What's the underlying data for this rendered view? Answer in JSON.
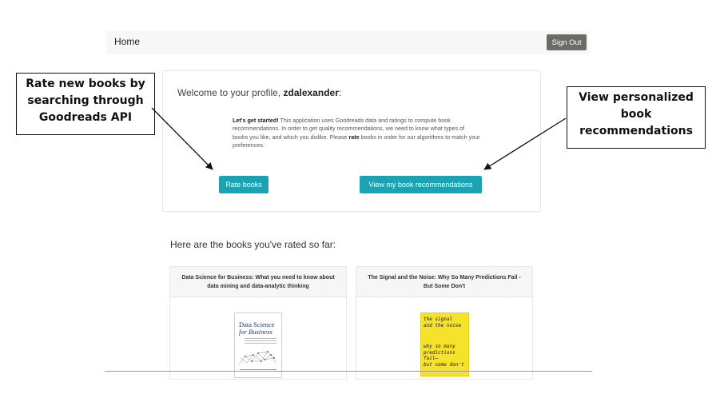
{
  "nav": {
    "home_label": "Home",
    "signout_label": "Sign Out"
  },
  "welcome": {
    "prefix": "Welcome to your profile, ",
    "username": "zdalexander",
    "suffix": ":",
    "intro_bold": "Let's get started!",
    "intro_text_1": " This application uses Goodreads data and ratings to compute book recommendations. In order to get quality recommendations, we need to know what types of books you like, and which you dislike. Please ",
    "intro_rate": "rate",
    "intro_text_2": " books in order for our algorithms to match your preferences.",
    "rate_button": "Rate books",
    "reco_button": "View my book recommendations"
  },
  "rated": {
    "title": "Here are the books you've rated so far:",
    "books": [
      {
        "title": "Data Science for Business: What you need to know about data mining and data-analytic thinking",
        "cover_title_1": "Data Science",
        "cover_title_2": "for Business"
      },
      {
        "title": "The Signal and the Noise: Why So Many Predictions Fail - But Some Don't",
        "cover_line_1": "the signal",
        "cover_line_2": "and the noise",
        "cover_line_3": "why so many",
        "cover_line_4": "predictions fail—",
        "cover_line_5": "but some don't"
      }
    ]
  },
  "callouts": {
    "left_1": "Rate new books by",
    "left_2": "searching through",
    "left_3": "Goodreads API",
    "right_1": "View personalized",
    "right_2": "book",
    "right_3": "recommendations"
  },
  "colors": {
    "accent": "#1aa3b5",
    "signout": "#6c6c66",
    "signal_cover": "#f7e22b"
  }
}
